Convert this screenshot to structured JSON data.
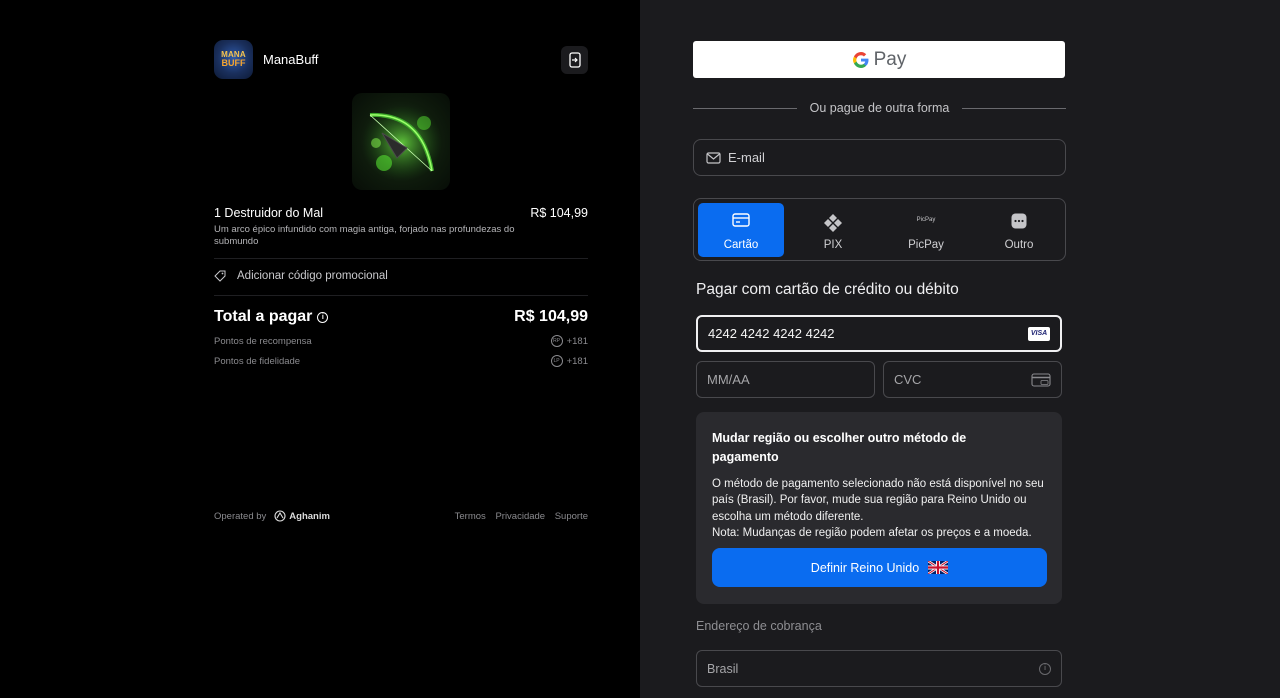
{
  "brand": {
    "name": "ManaBuff",
    "logo_line1": "MANA",
    "logo_line2": "BUFF"
  },
  "item": {
    "name": "1 Destruidor do Mal",
    "price": "R$ 104,99",
    "description": "Um arco épico infundido com magia antiga, forjado nas profundezas do submundo"
  },
  "promo": {
    "label": "Adicionar código promocional"
  },
  "total": {
    "label": "Total a pagar",
    "value": "R$ 104,99",
    "info_glyph": "i"
  },
  "points": [
    {
      "label": "Pontos de recompensa",
      "badge": "RP",
      "value": "+181"
    },
    {
      "label": "Pontos de fidelidade",
      "badge": "LP",
      "value": "+181"
    }
  ],
  "footer": {
    "operated_by": "Operated by",
    "operator": "Aghanim",
    "links": [
      "Termos",
      "Privacidade",
      "Suporte"
    ]
  },
  "gpay": {
    "label": "Pay"
  },
  "divider_text": "Ou pague de outra forma",
  "email": {
    "placeholder": "E-mail"
  },
  "methods": [
    {
      "label": "Cartão",
      "icon": "card-icon",
      "active": true
    },
    {
      "label": "PIX",
      "icon": "pix-icon",
      "active": false
    },
    {
      "label": "PicPay",
      "icon": "picpay-icon",
      "icon_text": "PicPay",
      "active": false
    },
    {
      "label": "Outro",
      "icon": "more-icon",
      "active": false
    }
  ],
  "card_section": {
    "title": "Pagar com cartão de crédito ou débito",
    "card_number": "4242 4242 4242 4242",
    "card_brand": "VISA",
    "expiry_placeholder": "MM/AA",
    "cvc_placeholder": "CVC"
  },
  "region_notice": {
    "title": "Mudar região ou escolher outro método de pagamento",
    "text": "O método de pagamento selecionado não está disponível no seu país (Brasil). Por favor, mude sua região para Reino Unido ou escolha um método diferente.",
    "note": "Nota: Mudanças de região podem afetar os preços e a moeda.",
    "button": "Definir Reino Unido"
  },
  "billing": {
    "label": "Endereço de cobrança",
    "country": "Brasil"
  },
  "colors": {
    "accent": "#0a6cf0",
    "panel_left": "#000000",
    "panel_right": "#1b1b1e"
  }
}
